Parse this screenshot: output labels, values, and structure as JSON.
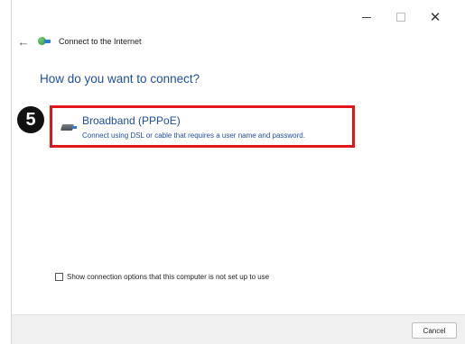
{
  "window": {
    "controls": {
      "minimize": "–",
      "maximize": "□",
      "close": "✕"
    }
  },
  "nav": {
    "back_icon": "back-arrow-icon",
    "app_icon": "network-connection-icon",
    "title": "Connect to the Internet"
  },
  "main": {
    "heading": "How do you want to connect?",
    "options": [
      {
        "icon": "broadband-modem-icon",
        "title": "Broadband (PPPoE)",
        "description": "Connect using DSL or cable that requires a user name and password.",
        "highlighted": true
      }
    ],
    "step_badge": "5",
    "checkbox": {
      "checked": false,
      "label": "Show connection options that this computer is not set up to use"
    }
  },
  "footer": {
    "cancel_label": "Cancel"
  },
  "colors": {
    "heading_blue": "#1e4e9c",
    "highlight_red": "#e0161e",
    "badge_black": "#111111",
    "footer_bg": "#f0f0f0"
  }
}
